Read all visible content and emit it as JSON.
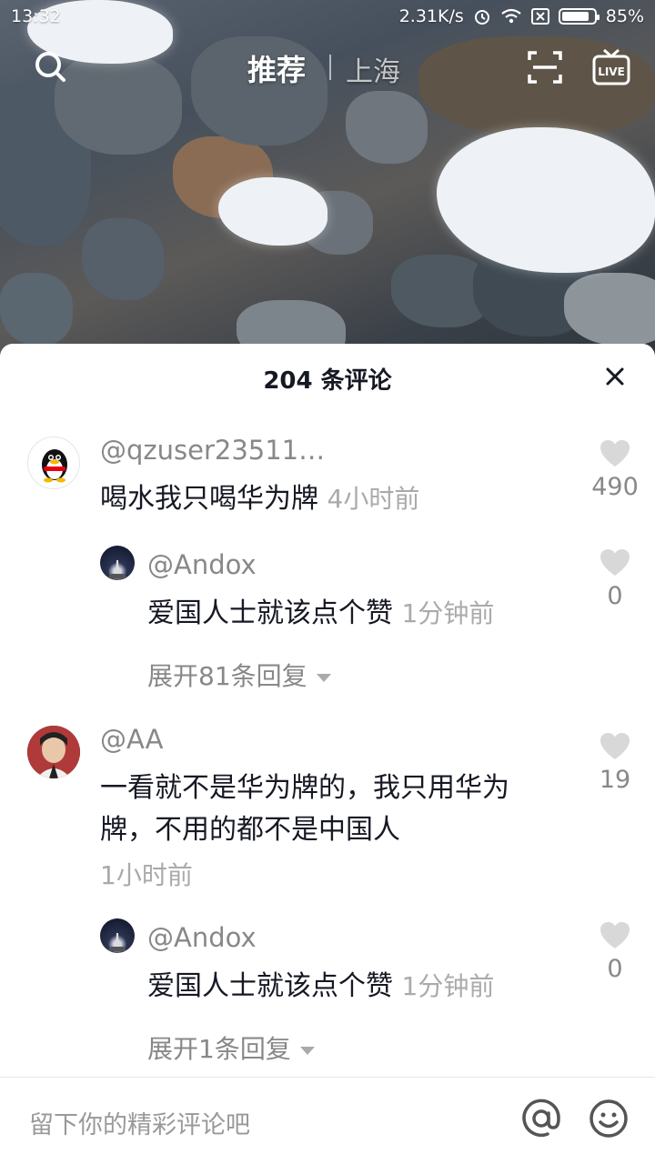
{
  "status_bar": {
    "time": "13:32",
    "net_speed": "2.31K/s",
    "battery": "85%"
  },
  "top_nav": {
    "tab_recommend": "推荐",
    "tab_city": "上海",
    "icons": [
      "search-icon",
      "scan-icon",
      "live-icon"
    ]
  },
  "comments_sheet": {
    "title": "204 条评论",
    "comments": [
      {
        "user": "@qzuser23511…",
        "text": "喝水我只喝华为牌",
        "time": "4小时前",
        "likes": "490",
        "reply": {
          "user": "@Andox",
          "text": "爱国人士就该点个赞",
          "time": "1分钟前",
          "likes": "0"
        },
        "expand": "展开81条回复"
      },
      {
        "user": "@AA",
        "text": "一看就不是华为牌的，我只用华为牌，不用的都不是中国人",
        "time": "1小时前",
        "likes": "19",
        "reply": {
          "user": "@Andox",
          "text": "爱国人士就该点个赞",
          "time": "1分钟前",
          "likes": "0"
        },
        "expand": "展开1条回复"
      }
    ]
  },
  "input_bar": {
    "placeholder": "留下你的精彩评论吧",
    "icons": [
      "at-icon",
      "emoji-icon"
    ]
  }
}
